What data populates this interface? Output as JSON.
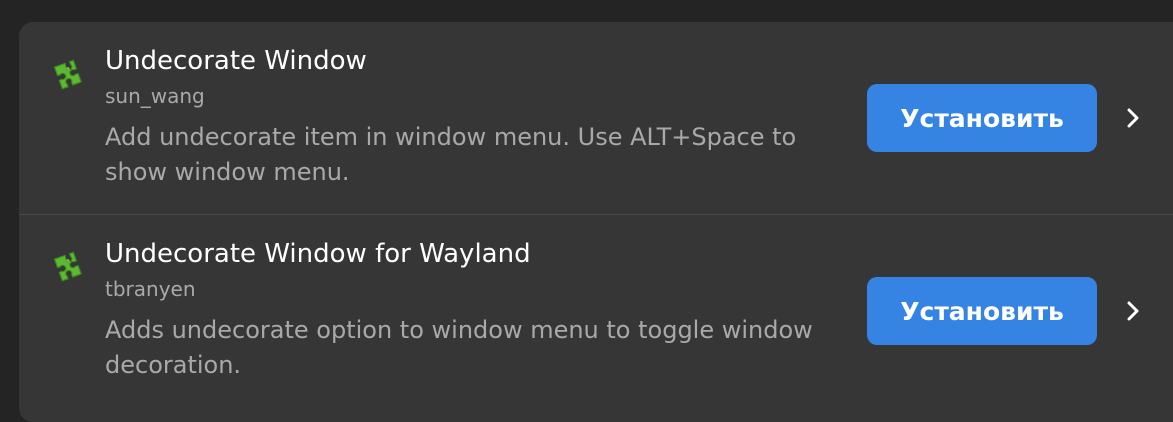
{
  "extensions": [
    {
      "icon": "puzzle-piece-icon",
      "title": "Undecorate Window",
      "author": "sun_wang",
      "description": "Add undecorate item in window menu. Use ALT+Space to show window menu.",
      "install_label": "Установить"
    },
    {
      "icon": "puzzle-piece-icon",
      "title": "Undecorate Window for Wayland",
      "author": "tbranyen",
      "description": "Adds undecorate option to window menu to toggle window decoration.",
      "install_label": "Установить"
    }
  ],
  "colors": {
    "window_bg": "#242424",
    "card_bg": "#363636",
    "accent": "#3584e4",
    "icon_green": "#5fb832"
  }
}
